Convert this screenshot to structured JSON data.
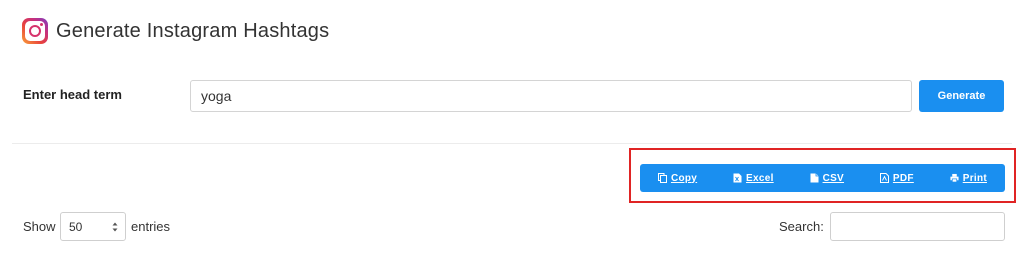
{
  "header": {
    "title": "Generate Instagram Hashtags",
    "icon": "instagram-icon"
  },
  "form": {
    "label": "Enter head term",
    "input_value": "yoga",
    "generate_label": "Generate"
  },
  "export": {
    "buttons": [
      {
        "label": "Copy",
        "icon": "copy-icon"
      },
      {
        "label": "Excel",
        "icon": "excel-file-icon"
      },
      {
        "label": "CSV",
        "icon": "csv-file-icon"
      },
      {
        "label": "PDF",
        "icon": "pdf-file-icon"
      },
      {
        "label": "Print",
        "icon": "print-icon"
      }
    ]
  },
  "table_controls": {
    "show_label": "Show",
    "page_size": "50",
    "entries_label": "entries",
    "search_label": "Search:",
    "search_value": ""
  },
  "colors": {
    "accent": "#1a8ff0",
    "highlight_border": "#e02424"
  }
}
